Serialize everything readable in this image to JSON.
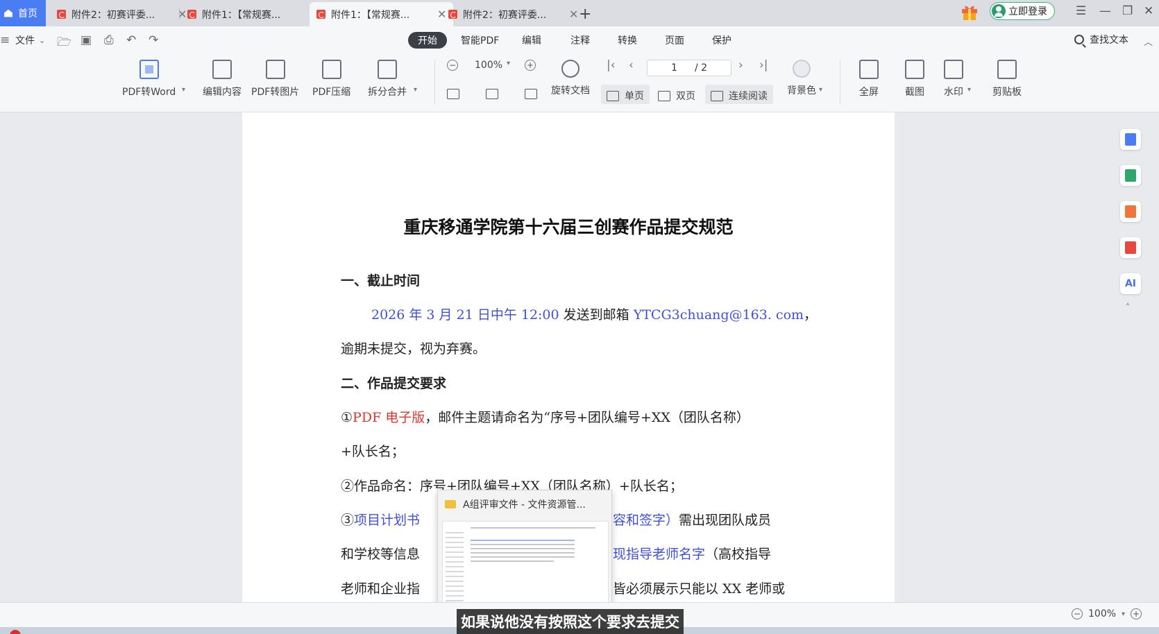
{
  "tabs": {
    "home": "首页",
    "items": [
      {
        "label": "附件2：初赛评委..."
      },
      {
        "label": "附件1：【常规赛..."
      },
      {
        "label": "附件1：【常规赛..."
      },
      {
        "label": "附件2：初赛评委..."
      }
    ],
    "new_tab": "+"
  },
  "header": {
    "login_label": "立即登录"
  },
  "menu": {
    "file": "文件",
    "tabs": [
      "开始",
      "智能PDF",
      "编辑",
      "注释",
      "转换",
      "页面",
      "保护"
    ],
    "find_text": "查找文本"
  },
  "toolbar": {
    "tools": [
      "PDF转Word",
      "编辑内容",
      "PDF转图片",
      "PDF压缩",
      "拆分合并"
    ],
    "zoom": "100%",
    "rotate": "旋转文档",
    "single_page": "单页",
    "double_page": "双页",
    "continuous": "连续阅读",
    "bg_color": "背景色",
    "page_current": "1",
    "page_total": "/ 2",
    "right_tools": [
      "全屏",
      "截图",
      "水印",
      "剪贴板"
    ]
  },
  "document": {
    "title": "重庆移通学院第十六届三创赛作品提交规范",
    "section1_heading": "一、截止时间",
    "deadline": "2026 年 3 月 21 日中午 12:00",
    "send_to": " 发送到邮箱 ",
    "email": "YTCG3chuang@163. com",
    "comma": "，",
    "overdue": "逾期未提交，视为弃赛。",
    "section2_heading": "二、作品提交要求",
    "req1_prefix": "①",
    "req1_red": "PDF 电子版",
    "req1_rest": "，邮件主题请命名为“序号+团队编号+XX（团队名称）",
    "req1_cont": "+队长名；",
    "req2": "②作品命名：序号+团队编号+XX（团队名称）+队长名；",
    "req3_prefix": "③",
    "req3_blue1": "项目计划书",
    "req3_blue2": "容和签字）",
    "req3_rest": "需出现团队成员",
    "req3_line2_a": "和学校等信息",
    "req3_line2_blue": "现指导老师名字",
    "req3_line2_b": "（高校指导",
    "req3_line3_a": "老师和企业指",
    "req3_line3_b": "皆必须展示只能以 XX 老师或"
  },
  "popup": {
    "title": "A组评审文件 - 文件资源管..."
  },
  "right_panel": {
    "ai_label": "AI"
  },
  "status": {
    "zoom": "100%"
  },
  "subtitle": "如果说他没有按照这个要求去提交"
}
